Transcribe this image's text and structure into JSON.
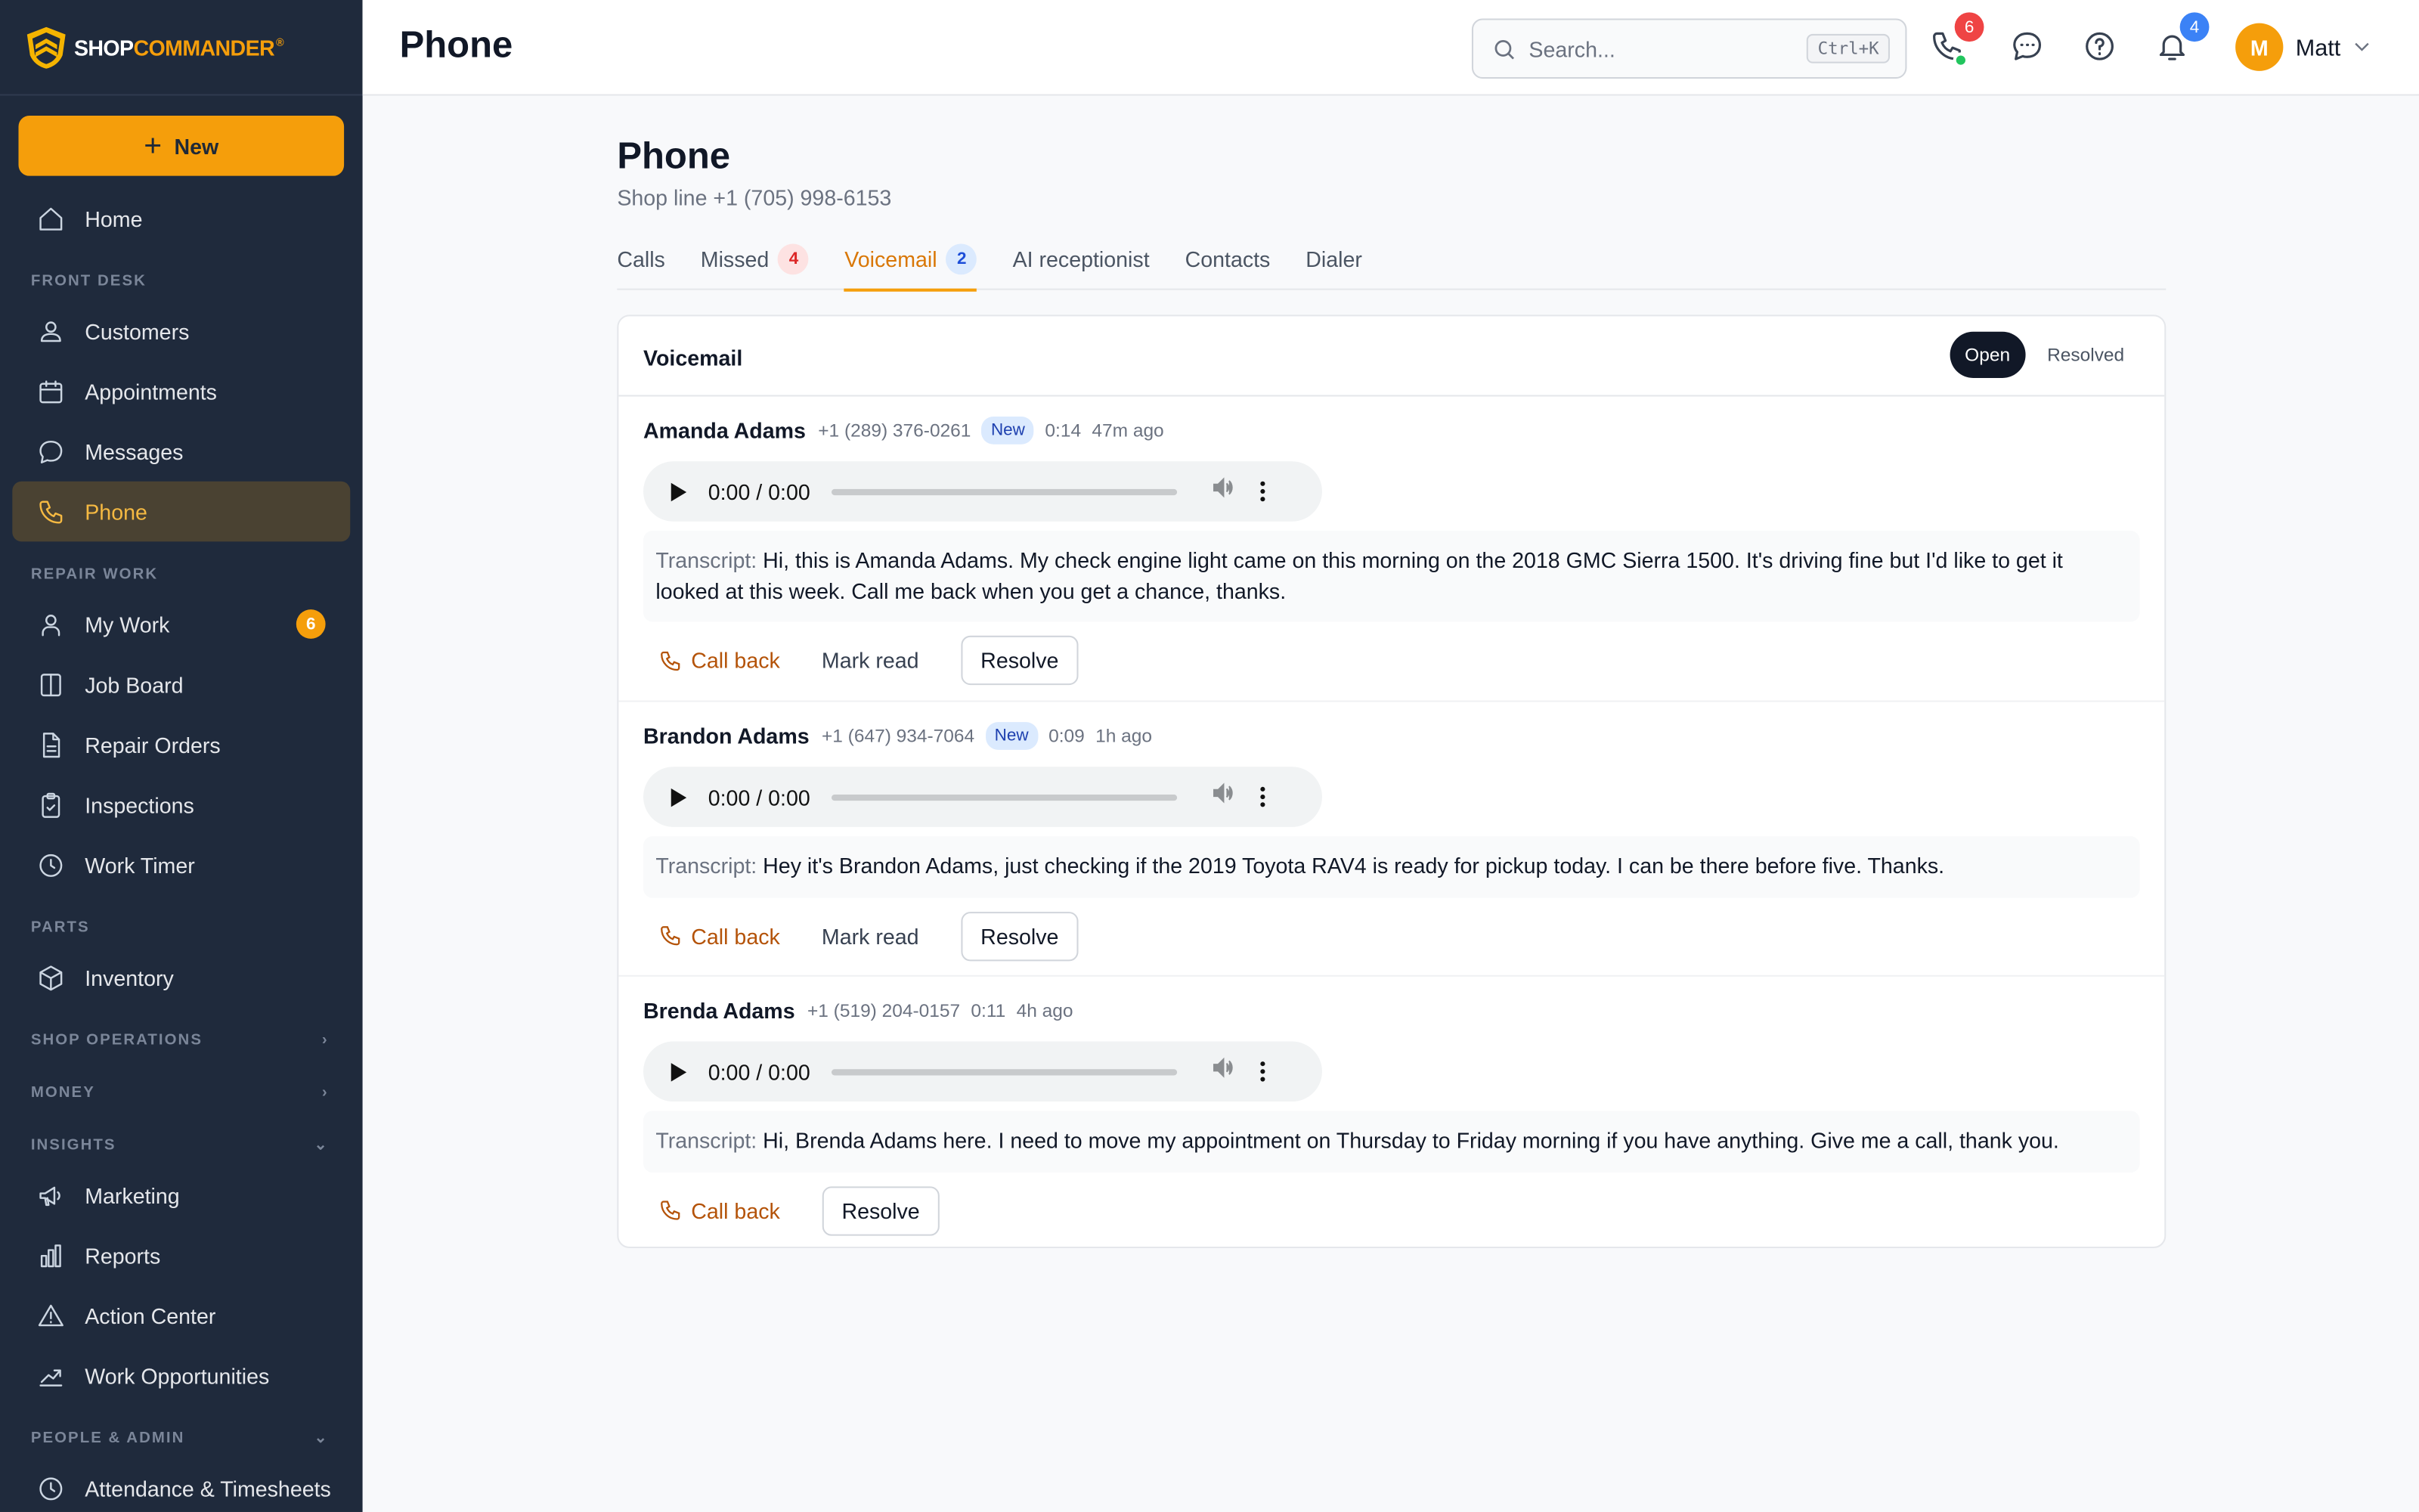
{
  "brand": {
    "name_a": "SHOP",
    "name_b": "COMMANDER",
    "reg": "®"
  },
  "sidebar": {
    "new_label": "New",
    "home": "Home",
    "sections": {
      "front_desk": "FRONT DESK",
      "repair_work": "REPAIR WORK",
      "parts": "PARTS",
      "shop_operations": "SHOP OPERATIONS",
      "money": "MONEY",
      "insights": "INSIGHTS",
      "people_admin": "PEOPLE & ADMIN"
    },
    "items": {
      "customers": "Customers",
      "appointments": "Appointments",
      "messages": "Messages",
      "phone": "Phone",
      "my_work": "My Work",
      "my_work_badge": "6",
      "job_board": "Job Board",
      "repair_orders": "Repair Orders",
      "inspections": "Inspections",
      "work_timer": "Work Timer",
      "inventory": "Inventory",
      "marketing": "Marketing",
      "reports": "Reports",
      "action_center": "Action Center",
      "work_opportunities": "Work Opportunities",
      "attendance": "Attendance & Timesheets"
    }
  },
  "header": {
    "title": "Phone",
    "search_placeholder": "Search...",
    "search_shortcut": "Ctrl+K",
    "phone_badge": "6",
    "notif_badge": "4",
    "user_initial": "M",
    "user_name": "Matt"
  },
  "main": {
    "title": "Phone",
    "subtitle": "Shop line +1 (705) 998-6153",
    "tabs": {
      "calls": "Calls",
      "missed": "Missed",
      "missed_count": "4",
      "voicemail": "Voicemail",
      "voicemail_count": "2",
      "ai": "AI receptionist",
      "contacts": "Contacts",
      "dialer": "Dialer"
    },
    "card": {
      "title": "Voicemail",
      "filter_open": "Open",
      "filter_resolved": "Resolved"
    },
    "labels": {
      "transcript": "Transcript:",
      "call_back": "Call back",
      "mark_read": "Mark read",
      "resolve": "Resolve",
      "player_time": "0:00 / 0:00"
    },
    "voicemails": [
      {
        "name": "Amanda Adams",
        "phone": "+1 (289) 376-0261",
        "badge": "New",
        "duration": "0:14",
        "ago": "47m ago",
        "transcript": "Hi, this is Amanda Adams. My check engine light came on this morning on the 2018 GMC Sierra 1500. It's driving fine but I'd like to get it looked at this week. Call me back when you get a chance, thanks."
      },
      {
        "name": "Brandon Adams",
        "phone": "+1 (647) 934-7064",
        "badge": "New",
        "duration": "0:09",
        "ago": "1h ago",
        "transcript": "Hey it's Brandon Adams, just checking if the 2019 Toyota RAV4 is ready for pickup today. I can be there before five. Thanks."
      },
      {
        "name": "Brenda Adams",
        "phone": "+1 (519) 204-0157",
        "duration": "0:11",
        "ago": "4h ago",
        "transcript": "Hi, Brenda Adams here. I need to move my appointment on Thursday to Friday morning if you have anything. Give me a call, thank you."
      }
    ]
  },
  "colors": {
    "accent": "#f59e0b",
    "sidebar_bg": "#1f2a3c",
    "active_bg": "#4a4232"
  },
  "icons": [
    "home-icon",
    "customers-icon",
    "calendar-icon",
    "chat-icon",
    "phone-icon",
    "user-icon",
    "board-icon",
    "document-icon",
    "clipboard-icon",
    "clock-icon",
    "box-icon",
    "megaphone-icon",
    "bar-chart-icon",
    "warning-icon",
    "trend-icon",
    "search-icon",
    "help-icon",
    "bell-icon"
  ]
}
